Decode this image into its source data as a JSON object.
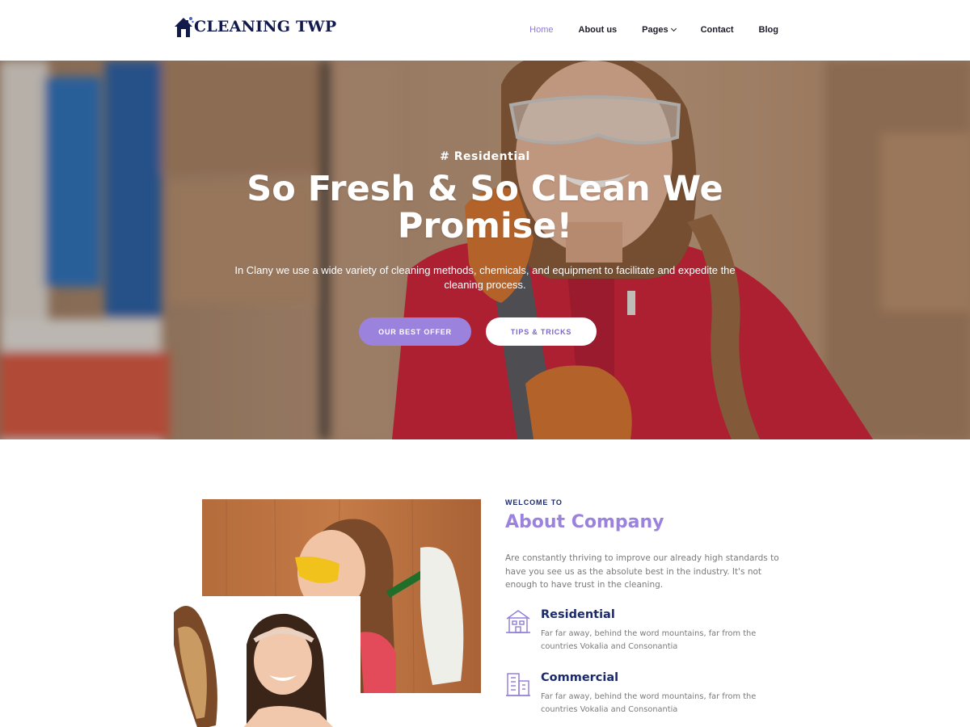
{
  "header": {
    "logo_text": "CLEANING TWP",
    "nav": [
      {
        "label": "Home",
        "active": true
      },
      {
        "label": "About us",
        "active": false
      },
      {
        "label": "Pages",
        "active": false,
        "has_dropdown": true
      },
      {
        "label": "Contact",
        "active": false
      },
      {
        "label": "Blog",
        "active": false
      }
    ]
  },
  "hero": {
    "subtitle": "# Residential",
    "title": "So Fresh & So CLean We Promise!",
    "description": "In Clany we use a wide variety of cleaning methods, chemicals, and equipment to facilitate and expedite the cleaning process.",
    "primary_button": "OUR BEST OFFER",
    "secondary_button": "TIPS & TRICKS"
  },
  "about": {
    "kicker": "WELCOME TO",
    "title": "About Company",
    "text": "Are constantly thriving to improve our already high standards to have you see us as the absolute best in the industry. It's not enough to have trust in the cleaning.",
    "features": [
      {
        "icon": "house-icon",
        "title": "Residential",
        "text": "Far far away, behind the word mountains, far from the countries Vokalia and Consonantia"
      },
      {
        "icon": "building-icon",
        "title": "Commercial",
        "text": "Far far away, behind the word mountains, far from the countries Vokalia and Consonantia"
      }
    ]
  },
  "colors": {
    "accent": "#9b82dd",
    "navy": "#1b2a6b",
    "hero_jacket": "#d42a3b"
  }
}
